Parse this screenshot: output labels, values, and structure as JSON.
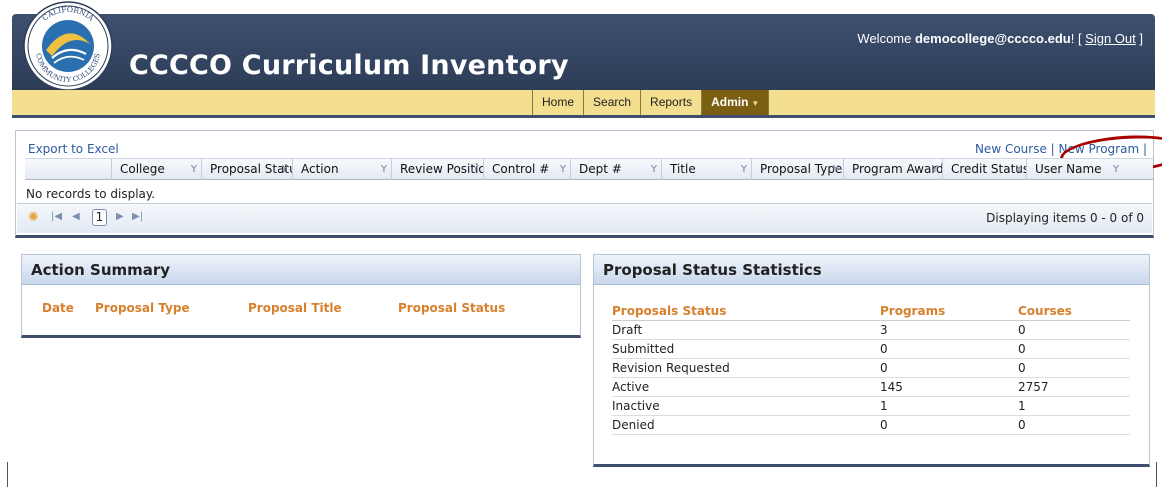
{
  "header": {
    "logo_text": "CALIFORNIA COMMUNITY COLLEGES",
    "title": "CCCCO Curriculum Inventory",
    "welcome_prefix": "Welcome ",
    "user_email": "democollege@cccco.edu",
    "welcome_suffix": "! [ ",
    "sign_out": "Sign Out",
    "welcome_end": " ]"
  },
  "nav": {
    "items": [
      {
        "label": "Home"
      },
      {
        "label": "Search"
      },
      {
        "label": "Reports"
      },
      {
        "label": "Admin"
      }
    ]
  },
  "grid": {
    "export_label": "Export to Excel",
    "new_course": "New Course",
    "new_sep": " | ",
    "new_program": "New Program",
    "new_tail": " |",
    "columns": [
      {
        "label": ""
      },
      {
        "label": "College"
      },
      {
        "label": "Proposal Status"
      },
      {
        "label": "Action"
      },
      {
        "label": "Review Position"
      },
      {
        "label": "Control #"
      },
      {
        "label": "Dept #"
      },
      {
        "label": "Title"
      },
      {
        "label": "Proposal Type"
      },
      {
        "label": "Program Award"
      },
      {
        "label": "Credit Status"
      },
      {
        "label": "User Name"
      }
    ],
    "empty_text": "No records to display.",
    "pager": {
      "page": "1",
      "display_text": "Displaying items 0 - 0 of 0"
    }
  },
  "action_summary": {
    "title": "Action Summary",
    "headers": [
      "Date",
      "Proposal Type",
      "Proposal Title",
      "Proposal Status"
    ]
  },
  "proposal_stats": {
    "title": "Proposal Status Statistics",
    "headers": [
      "Proposals Status",
      "Programs",
      "Courses"
    ],
    "rows": [
      {
        "status": "Draft",
        "programs": "3",
        "courses": "0"
      },
      {
        "status": "Submitted",
        "programs": "0",
        "courses": "0"
      },
      {
        "status": "Revision Requested",
        "programs": "0",
        "courses": "0"
      },
      {
        "status": "Active",
        "programs": "145",
        "courses": "2757"
      },
      {
        "status": "Inactive",
        "programs": "1",
        "courses": "1"
      },
      {
        "status": "Denied",
        "programs": "0",
        "courses": "0"
      }
    ]
  },
  "colors": {
    "header_bg": "#3e5070",
    "nav_bg": "#f3df8f",
    "nav_active": "#7a5f13",
    "accent_orange": "#d8802c",
    "link": "#2b5aa0",
    "highlight_circle": "#aa0000"
  },
  "icons": [
    "college-seal-logo",
    "filter-icon",
    "refresh-icon",
    "first-page-icon",
    "prev-page-icon",
    "next-page-icon",
    "last-page-icon",
    "dropdown-caret-icon"
  ]
}
